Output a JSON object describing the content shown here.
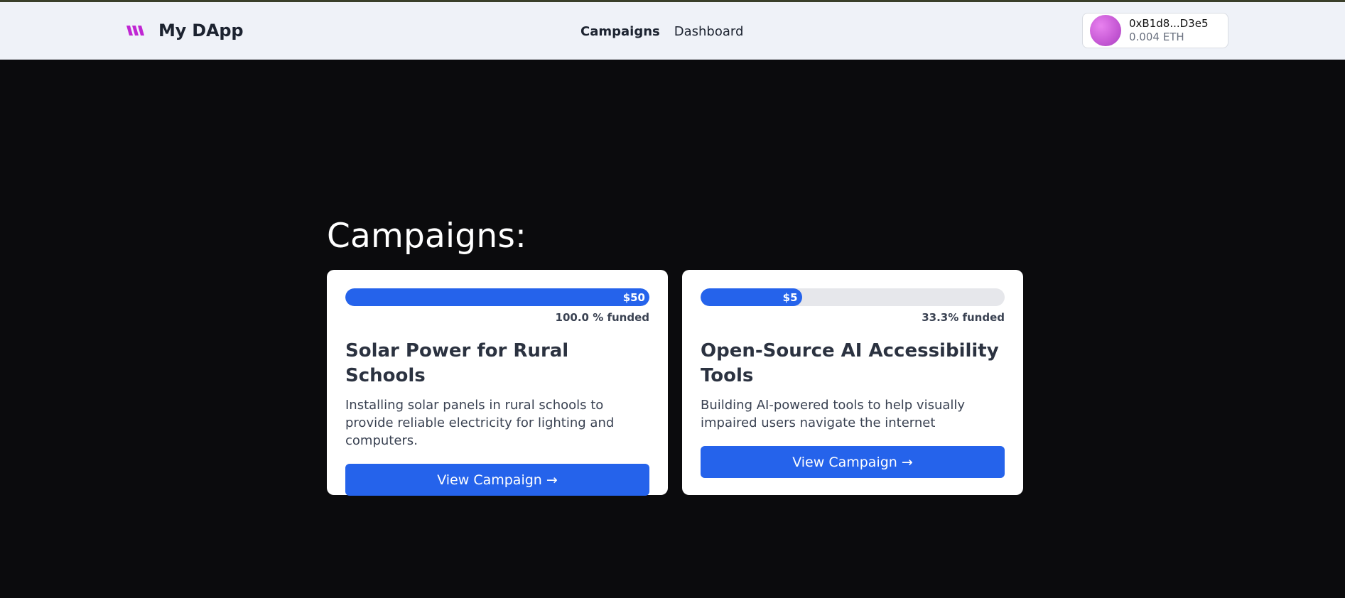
{
  "app": {
    "name": "My DApp"
  },
  "nav": {
    "items": [
      {
        "label": "Campaigns",
        "active": true
      },
      {
        "label": "Dashboard",
        "active": false
      }
    ]
  },
  "wallet": {
    "address": "0xB1d8...D3e5",
    "balance": "0.004 ETH"
  },
  "page": {
    "heading": "Campaigns:"
  },
  "campaigns": [
    {
      "raised": "$50",
      "progress_percent": 100,
      "funded_text": "100.0 % funded",
      "title": "Solar Power for Rural Schools",
      "description": "Installing solar panels in rural schools to provide reliable electricity for lighting and computers.",
      "button": "View Campaign →"
    },
    {
      "raised": "$5",
      "progress_percent": 33.3,
      "funded_text": "33.3% funded",
      "title": "Open-Source AI Accessibility Tools",
      "description": "Building AI-powered tools to help visually impaired users navigate the internet",
      "button": "View Campaign →"
    }
  ],
  "colors": {
    "accent": "#2563eb",
    "navbar_bg": "#eff2f8",
    "page_bg": "#0b0b0d",
    "logo": "#c026d3"
  },
  "icons": {
    "logo": "brand-logo-icon",
    "avatar": "wallet-avatar"
  }
}
